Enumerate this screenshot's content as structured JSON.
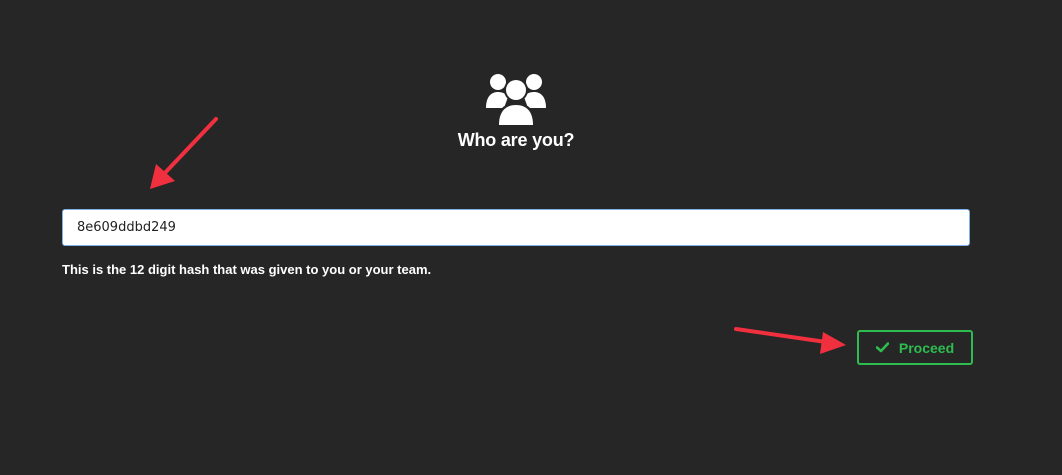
{
  "header": {
    "icon": "users-group-icon",
    "title": "Who are you?"
  },
  "form": {
    "hash_value": "8e609ddbd249",
    "helper_text": "This is the 12 digit hash that was given to you or your team."
  },
  "actions": {
    "proceed_label": "Proceed",
    "proceed_icon": "check-icon"
  },
  "colors": {
    "background": "#262626",
    "accent_green": "#2ebc4f",
    "annotation_red": "#f0303f"
  }
}
